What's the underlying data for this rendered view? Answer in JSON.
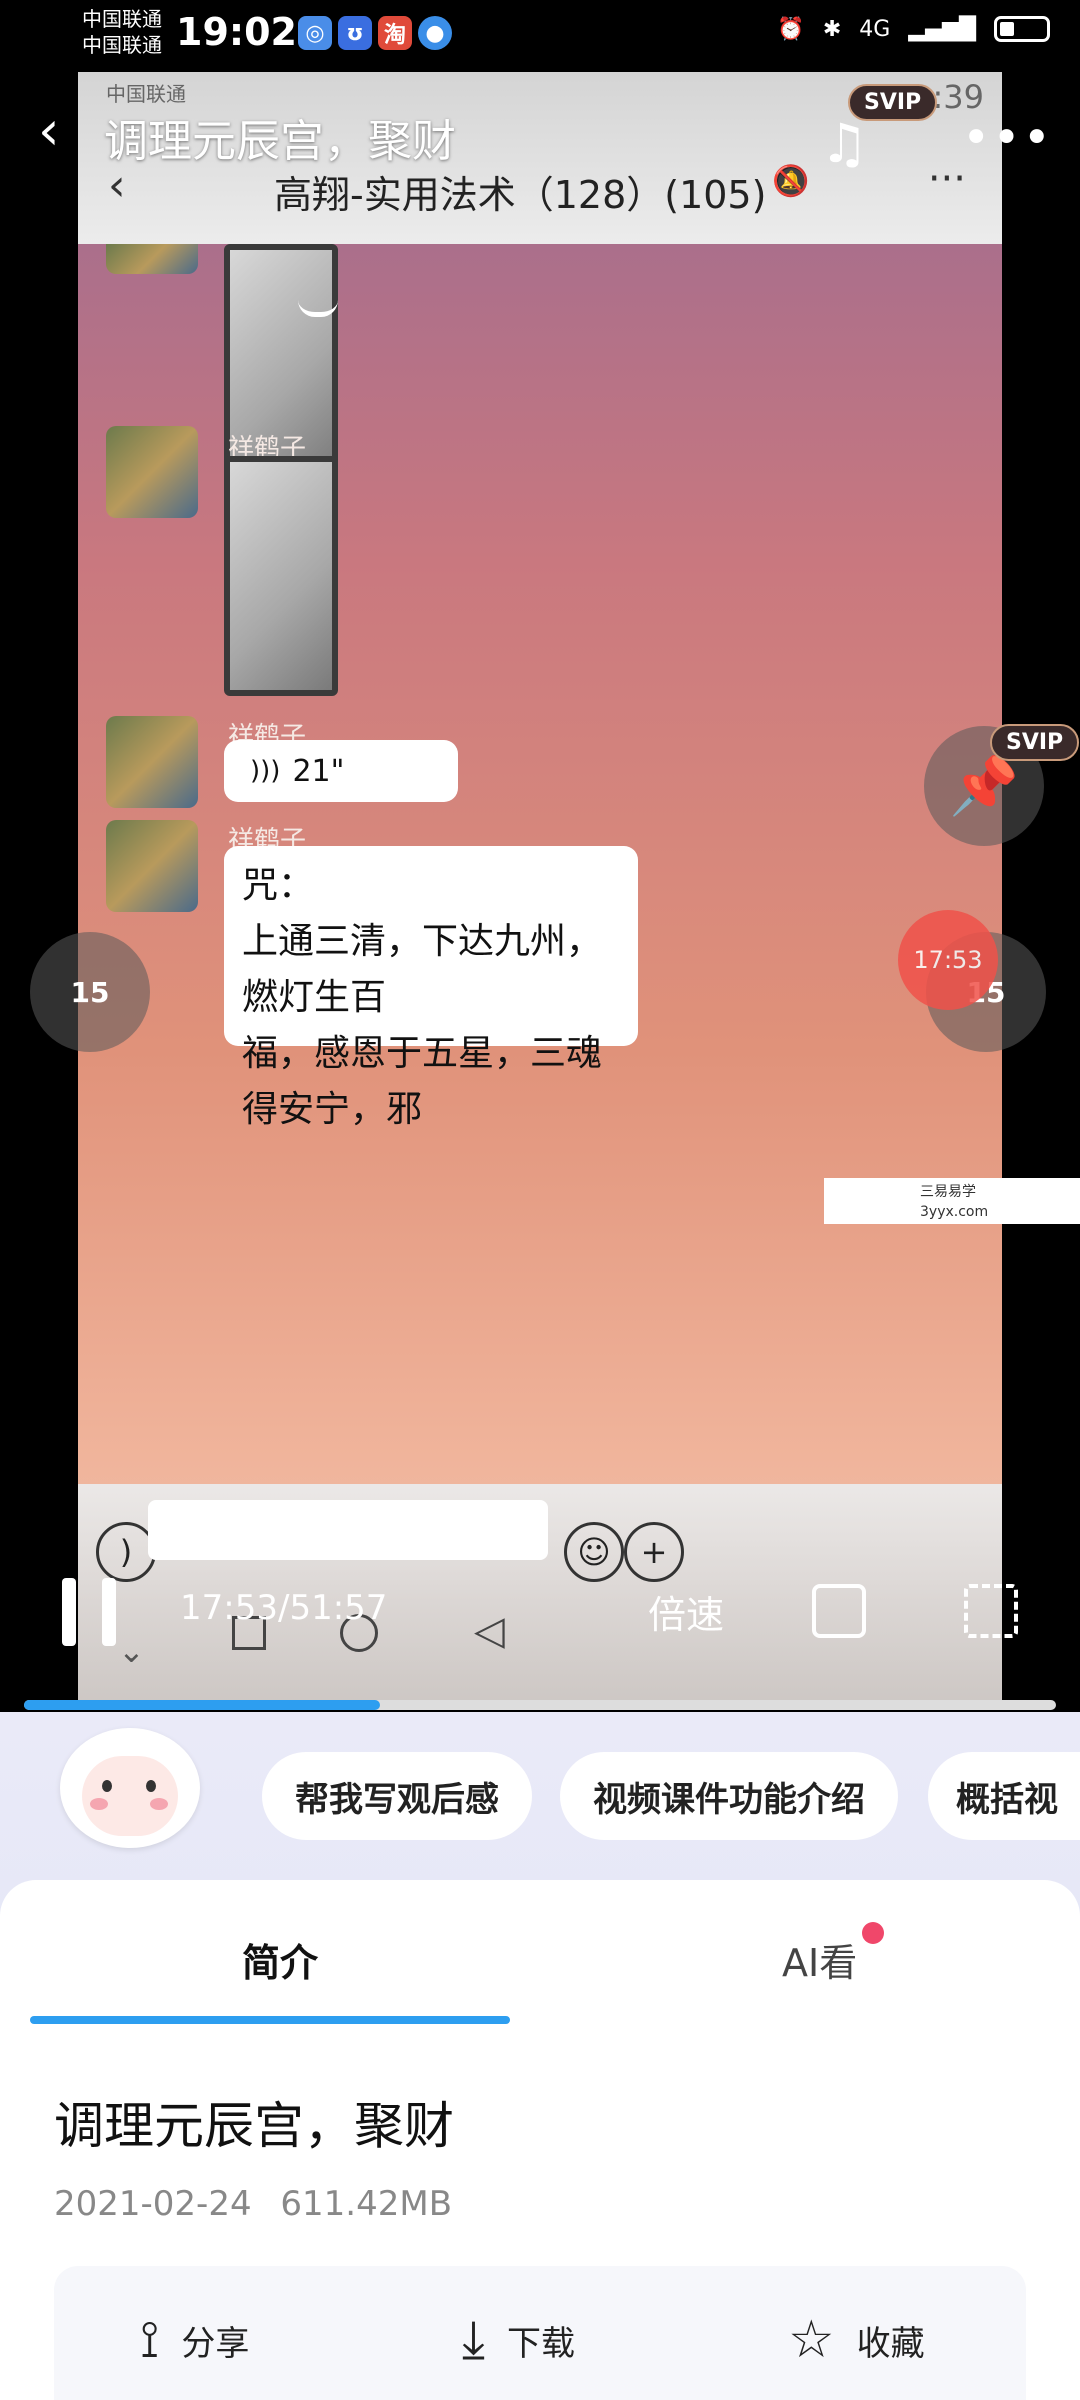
{
  "status": {
    "carrier1": "中国联通",
    "carrier2": "中国联通",
    "time": "19:02",
    "apps": [
      "淘"
    ],
    "network": "4G"
  },
  "video": {
    "overlay_title": "调理元辰宫，聚财",
    "inner_carrier": "中国联通",
    "inner_time": ":39",
    "chat_title": "高翔-实用法术（128）(105)",
    "sender": "祥鹤子",
    "voice_duration": "21\"",
    "message_lines": [
      "咒：",
      "上通三清，下达九州，燃灯生百",
      "福，感恩于五星，三魂得安宁，邪"
    ],
    "watermark_line1": "三易易学",
    "watermark_line2": "3yyx.com",
    "skip_back": "15",
    "skip_forward": "15",
    "float_time": "17:53",
    "svip": "SVIP",
    "current_time": "17:53",
    "duration": "51:57",
    "speed_label": "倍速",
    "progress": 0.345
  },
  "ai": {
    "chips": [
      "帮我写观后感",
      "视频课件功能介绍",
      "概括视"
    ]
  },
  "sheet": {
    "tabs": [
      "简介",
      "AI看"
    ],
    "title": "调理元辰宫，聚财",
    "date": "2021-02-24",
    "size": "611.42MB",
    "actions": [
      "分享",
      "下载",
      "收藏"
    ]
  },
  "colors": {
    "accent": "#2d9ef0",
    "badge": "#f0476a"
  }
}
